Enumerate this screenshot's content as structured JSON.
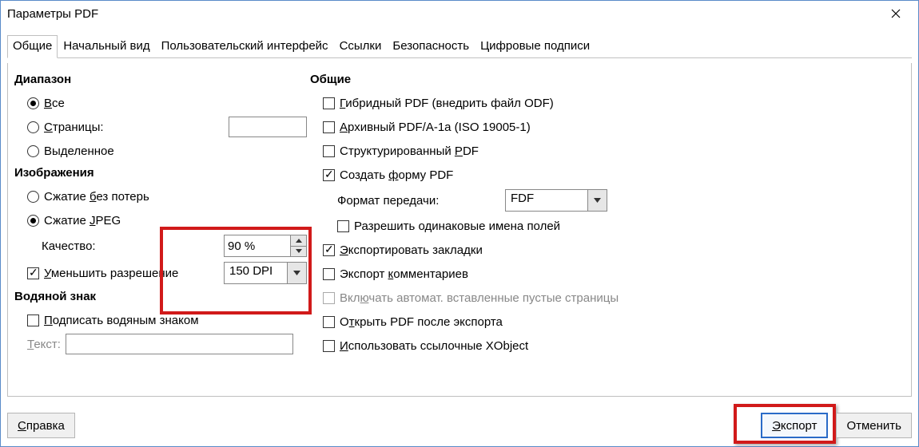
{
  "window": {
    "title": "Параметры PDF"
  },
  "tabs": {
    "general": "Общие",
    "initial_view": "Начальный вид",
    "user_interface": "Пользовательский интерфейс",
    "links": "Ссылки",
    "security": "Безопасность",
    "signatures": "Цифровые подписи"
  },
  "range": {
    "heading": "Диапазон",
    "all": "Все",
    "pages": "Страницы:",
    "pages_value": "",
    "selection": "Выделенное"
  },
  "images": {
    "heading": "Изображения",
    "lossless": "Сжатие без потерь",
    "jpeg": "Сжатие JPEG",
    "quality_label": "Качество:",
    "quality_value": "90 %",
    "reduce_res": "Уменьшить разрешение",
    "dpi_value": "150 DPI"
  },
  "watermark": {
    "heading": "Водяной знак",
    "sign": "Подписать водяным знаком",
    "text_label": "Текст:",
    "text_value": ""
  },
  "general": {
    "heading": "Общие",
    "hybrid": "Гибридный PDF (внедрить файл ODF)",
    "archive": "Архивный PDF/A-1a (ISO 19005-1)",
    "structured": "Структурированный PDF",
    "create_form": "Создать форму PDF",
    "format_label": "Формат передачи:",
    "format_value": "FDF",
    "allow_dup": "Разрешить одинаковые имена полей",
    "bookmarks": "Экспортировать закладки",
    "comments": "Экспорт комментариев",
    "blank_pages": "Включать автомат. вставленные пустые страницы",
    "open_after": "Открыть PDF после экспорта",
    "xobject": "Использовать ссылочные XObject"
  },
  "buttons": {
    "help": "Справка",
    "export": "Экспорт",
    "cancel": "Отменить"
  }
}
